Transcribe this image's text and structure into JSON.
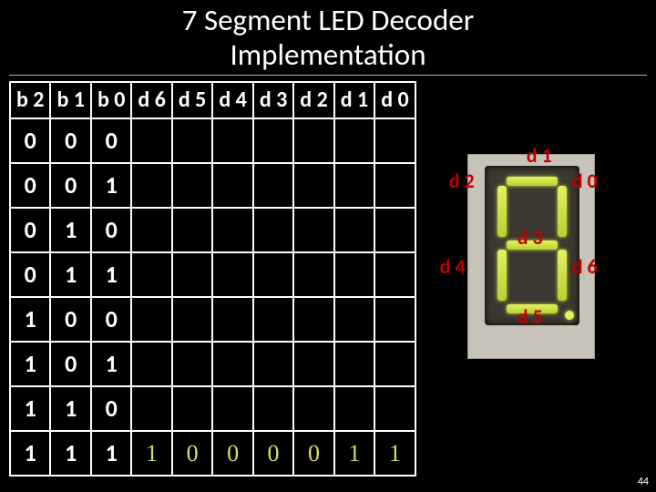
{
  "title_line1": "7  Segment  LED  Decoder",
  "title_line2": "Implementation",
  "page_number": "44",
  "table": {
    "headers": [
      "b 2",
      "b 1",
      "b 0",
      "d 6",
      "d 5",
      "d 4",
      "d 3",
      "d 2",
      "d 1",
      "d 0"
    ],
    "rows": [
      {
        "b": [
          "0",
          "0",
          "0"
        ],
        "d": [
          "",
          "",
          "",
          "",
          "",
          "",
          ""
        ]
      },
      {
        "b": [
          "0",
          "0",
          "1"
        ],
        "d": [
          "",
          "",
          "",
          "",
          "",
          "",
          ""
        ]
      },
      {
        "b": [
          "0",
          "1",
          "0"
        ],
        "d": [
          "",
          "",
          "",
          "",
          "",
          "",
          ""
        ]
      },
      {
        "b": [
          "0",
          "1",
          "1"
        ],
        "d": [
          "",
          "",
          "",
          "",
          "",
          "",
          ""
        ]
      },
      {
        "b": [
          "1",
          "0",
          "0"
        ],
        "d": [
          "",
          "",
          "",
          "",
          "",
          "",
          ""
        ]
      },
      {
        "b": [
          "1",
          "0",
          "1"
        ],
        "d": [
          "",
          "",
          "",
          "",
          "",
          "",
          ""
        ]
      },
      {
        "b": [
          "1",
          "1",
          "0"
        ],
        "d": [
          "",
          "",
          "",
          "",
          "",
          "",
          ""
        ]
      },
      {
        "b": [
          "1",
          "1",
          "1"
        ],
        "d": [
          "1",
          "0",
          "0",
          "0",
          "0",
          "1",
          "1"
        ]
      }
    ]
  },
  "seg_labels": {
    "d0": "d 0",
    "d1": "d 1",
    "d2": "d 2",
    "d3": "d 3",
    "d4": "d 4",
    "d5": "d 5",
    "d6": "d 6"
  }
}
